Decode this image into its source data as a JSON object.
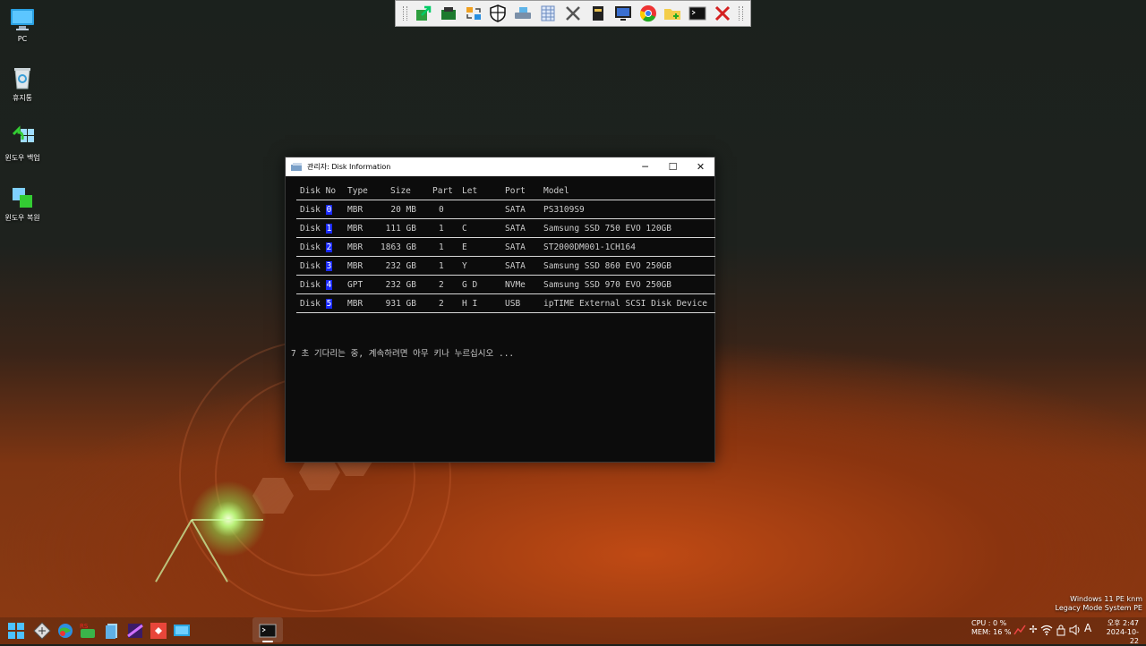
{
  "desktop": {
    "icons": [
      {
        "label": "PC"
      },
      {
        "label": "휴지통"
      },
      {
        "label": "윈도우 백업"
      },
      {
        "label": "윈도우 복원"
      }
    ]
  },
  "toolbar": {
    "buttons": [
      "export-icon",
      "card-icon",
      "transfer-icon",
      "shield-icon",
      "drive-icon",
      "grid-icon",
      "tools-icon",
      "book-icon",
      "monitor-icon",
      "chrome-icon",
      "folder-add-icon",
      "terminal-icon",
      "close-x-icon"
    ]
  },
  "window": {
    "title": "관리자: Disk Information",
    "minimize": "─",
    "maximize": "☐",
    "close": "✕"
  },
  "table": {
    "headers": {
      "disk": "Disk No",
      "type": "Type",
      "size": "Size",
      "part": "Part",
      "let": "Let",
      "port": "Port",
      "model": "Model"
    },
    "rows": [
      {
        "disk": "Disk",
        "num": "0",
        "type": "MBR",
        "size": "20 MB",
        "part": "0",
        "let": "",
        "port": "SATA",
        "model": "PS3109S9"
      },
      {
        "disk": "Disk",
        "num": "1",
        "type": "MBR",
        "size": "111 GB",
        "part": "1",
        "let": "C",
        "port": "SATA",
        "model": "Samsung SSD 750 EVO 120GB"
      },
      {
        "disk": "Disk",
        "num": "2",
        "type": "MBR",
        "size": "1863 GB",
        "part": "1",
        "let": "E",
        "port": "SATA",
        "model": "ST2000DM001-1CH164"
      },
      {
        "disk": "Disk",
        "num": "3",
        "type": "MBR",
        "size": "232 GB",
        "part": "1",
        "let": "Y",
        "port": "SATA",
        "model": "Samsung SSD 860 EVO 250GB"
      },
      {
        "disk": "Disk",
        "num": "4",
        "type": "GPT",
        "size": "232 GB",
        "part": "2",
        "let": "G D",
        "port": "NVMe",
        "model": "Samsung SSD 970 EVO 250GB"
      },
      {
        "disk": "Disk",
        "num": "5",
        "type": "MBR",
        "size": "931 GB",
        "part": "2",
        "let": "H I",
        "port": "USB",
        "model": "ipTIME External SCSI Disk Device"
      }
    ]
  },
  "console": {
    "wait_message": "7 초 기다리는 중, 계속하려면 아무 키나 누르십시오 ..."
  },
  "system": {
    "os_line1": "Windows 11 PE knm",
    "os_line2": "Legacy Mode System PE",
    "cpu": "CPU :   0 %",
    "mem": "MEM: 16 %",
    "ime": "A",
    "time": "오후 2:47",
    "date": "2024-10-22"
  }
}
